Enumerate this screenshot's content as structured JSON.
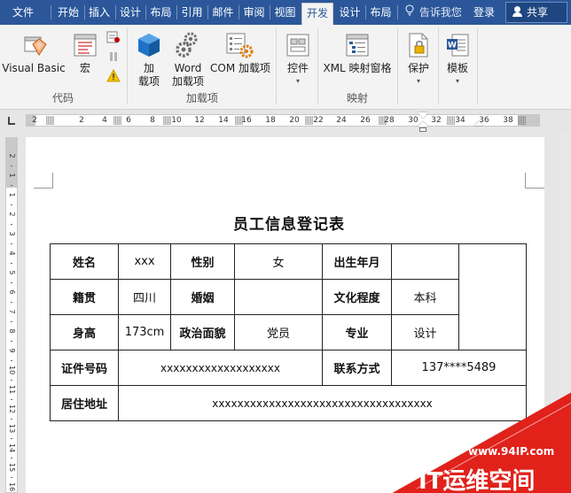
{
  "tabs": [
    {
      "label": "文件",
      "active": false
    },
    {
      "label": "开始",
      "active": false
    },
    {
      "label": "插入",
      "active": false
    },
    {
      "label": "设计",
      "active": false
    },
    {
      "label": "布局",
      "active": false
    },
    {
      "label": "引用",
      "active": false
    },
    {
      "label": "邮件",
      "active": false
    },
    {
      "label": "审阅",
      "active": false
    },
    {
      "label": "视图",
      "active": false
    },
    {
      "label": "开发",
      "active": true
    },
    {
      "label": "设计",
      "active": false
    },
    {
      "label": "布局",
      "active": false
    }
  ],
  "tell_me": "告诉我您",
  "login": "登录",
  "share": "共享",
  "ribbon": {
    "visual_basic": "Visual Basic",
    "macro": "宏",
    "addin_1": "加",
    "addin_2": "载项",
    "word_addin_1": "Word",
    "word_addin_2": "加载项",
    "com_addin": "COM 加载项",
    "controls": "控件",
    "xml_pane": "XML 映射窗格",
    "protect": "保护",
    "template": "模板",
    "groups": {
      "code": "代码",
      "addins": "加载项",
      "mapping": "映射"
    }
  },
  "ruler": {
    "h_labels": [
      "2",
      "2",
      "4",
      "6",
      "8",
      "10",
      "12",
      "14",
      "16",
      "18",
      "20",
      "22",
      "24",
      "26",
      "28",
      "30",
      "32",
      "34",
      "36",
      "38",
      "40"
    ],
    "v_labels": [
      "2",
      "1",
      "1",
      "2",
      "3",
      "4",
      "5",
      "6",
      "7",
      "8",
      "9",
      "10",
      "11",
      "12",
      "13",
      "14",
      "15",
      "16"
    ]
  },
  "document": {
    "title": "员工信息登记表",
    "rows": [
      [
        "姓名",
        "xxx",
        "性别",
        "女",
        "出生年月",
        ""
      ],
      [
        "籍贯",
        "四川",
        "婚姻",
        "",
        "文化程度",
        "本科"
      ],
      [
        "身高",
        "173cm",
        "政治面貌",
        "党员",
        "专业",
        "设计"
      ],
      [
        "证件号码",
        "xxxxxxxxxxxxxxxxxxx",
        "联系方式",
        "137****5489"
      ],
      [
        "居住地址",
        "xxxxxxxxxxxxxxxxxxxxxxxxxxxxxxxxxxx"
      ]
    ]
  },
  "watermark": {
    "url": "www.94IP.com",
    "brand": "IT运维空间"
  },
  "colors": {
    "accent": "#2b579a",
    "watermark_red": "#e0221b"
  }
}
